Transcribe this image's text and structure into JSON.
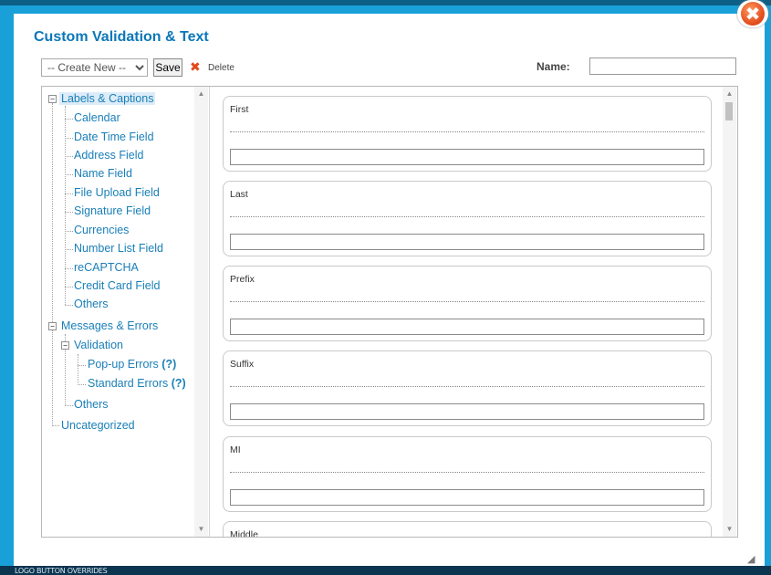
{
  "dialog": {
    "title": "Custom Validation & Text",
    "close_icon": "close-x-icon"
  },
  "toolbar": {
    "create_select": {
      "selected": "-- Create New --",
      "options": [
        "-- Create New --"
      ]
    },
    "save_label": "Save",
    "delete_label": "Delete",
    "delete_icon": "red-x-icon",
    "name_label": "Name:",
    "name_value": ""
  },
  "tree": {
    "labels_captions": "Labels & Captions",
    "items": [
      "Calendar",
      "Date Time Field",
      "Address Field",
      "Name Field",
      "File Upload Field",
      "Signature Field",
      "Currencies",
      "Number List Field",
      "reCAPTCHA",
      "Credit Card Field",
      "Others"
    ],
    "messages_errors": "Messages & Errors",
    "validation": "Validation",
    "popup_errors": "Pop-up Errors",
    "standard_errors": "Standard Errors",
    "help_mark": "(?)",
    "messages_others": "Others",
    "uncategorized": "Uncategorized"
  },
  "fields": [
    {
      "label": "First",
      "value": ""
    },
    {
      "label": "Last",
      "value": ""
    },
    {
      "label": "Prefix",
      "value": ""
    },
    {
      "label": "Suffix",
      "value": ""
    },
    {
      "label": "MI",
      "value": ""
    },
    {
      "label": "Middle",
      "value": ""
    }
  ],
  "footer": {
    "partial_text": "LOGO BUTTON OVERRIDES"
  },
  "colors": {
    "accent": "#0b77b9",
    "link": "#1a7fb8",
    "frame": "#1aa0d8",
    "close": "#e0481b"
  }
}
